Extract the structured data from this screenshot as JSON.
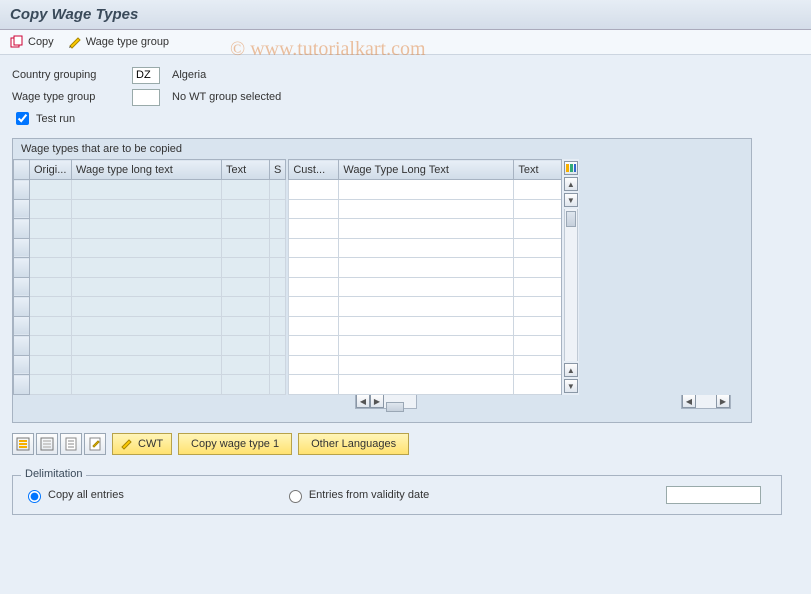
{
  "title": "Copy Wage Types",
  "toolbar": {
    "copy_label": "Copy",
    "wtgroup_label": "Wage type group"
  },
  "form": {
    "country_label": "Country grouping",
    "country_value": "DZ",
    "country_name": "Algeria",
    "wtgroup_label": "Wage type group",
    "wtgroup_value": "",
    "wtgroup_readout": "No WT group selected",
    "testrun_label": "Test run",
    "testrun_checked": true
  },
  "table": {
    "caption": "Wage types that are to be copied",
    "left_headers": [
      "Origi...",
      "Wage type long text",
      "Text",
      "S"
    ],
    "right_headers": [
      "Cust...",
      "Wage Type Long Text",
      "Text"
    ],
    "row_count": 11
  },
  "buttons": {
    "cwt": "CWT",
    "copy1": "Copy wage type 1",
    "other_lang": "Other Languages"
  },
  "delimitation": {
    "legend": "Delimitation",
    "opt_all": "Copy all entries",
    "opt_from": "Entries from validity date",
    "date_value": ""
  },
  "watermark": "©   www.tutorialkart.com"
}
